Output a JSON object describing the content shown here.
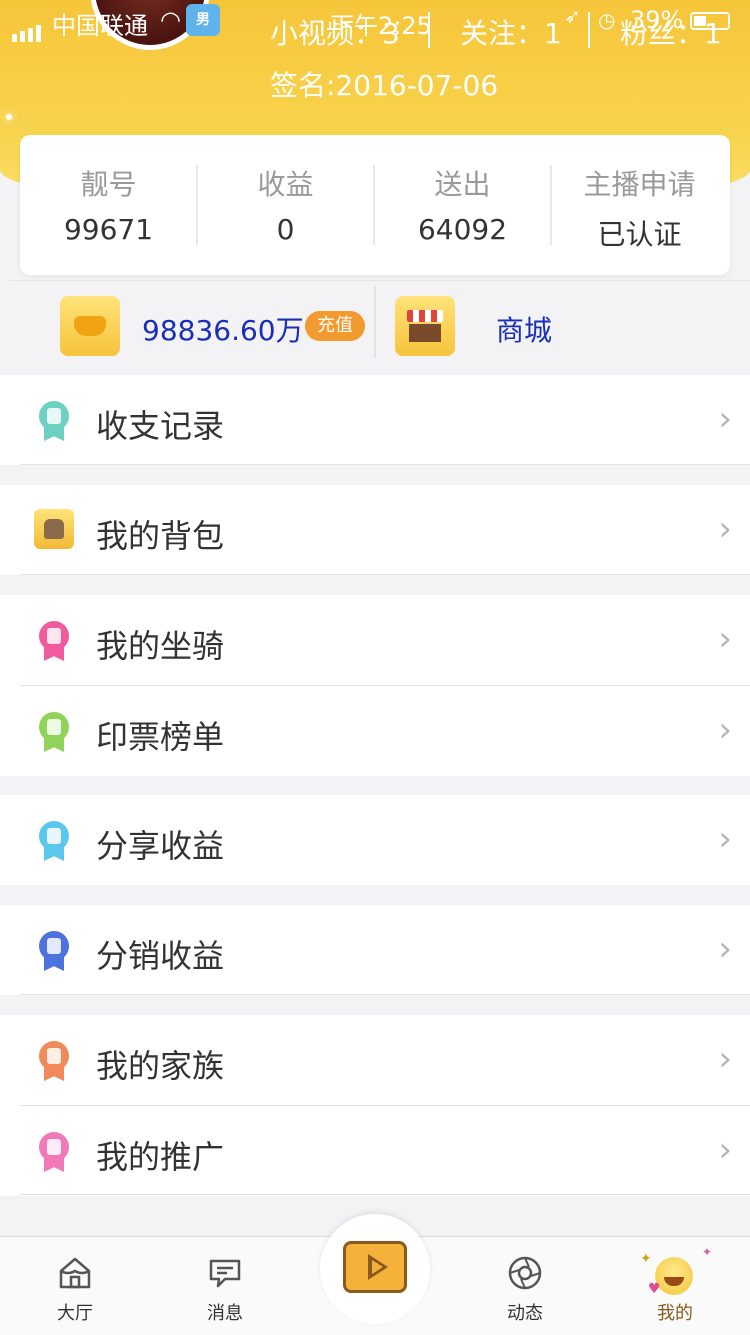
{
  "status_bar": {
    "carrier": "中国联通",
    "wifi_icon": "wifi-icon",
    "time": "下午2:25",
    "battery_percent": "39%"
  },
  "profile": {
    "gender_badge": "男",
    "stats": [
      {
        "label": "小视频：3"
      },
      {
        "label": "关注：1"
      },
      {
        "label": "粉丝：1"
      }
    ],
    "signature": "签名:2016-07-06"
  },
  "info_card": [
    {
      "label": "靓号",
      "value": "99671"
    },
    {
      "label": "收益",
      "value": "0"
    },
    {
      "label": "送出",
      "value": "64092"
    },
    {
      "label": "主播申请",
      "value": "已认证"
    }
  ],
  "wallet": {
    "coins": "98836.60万",
    "recharge_label": "充值",
    "shop_label": "商城"
  },
  "menu_groups": [
    [
      {
        "label": "收支记录",
        "icon": "ribbon-record-icon",
        "color": "#6cd0c2"
      }
    ],
    [
      {
        "label": "我的背包",
        "icon": "backpack-icon",
        "color": "#f4c34a"
      }
    ],
    [
      {
        "label": "我的坐骑",
        "icon": "ribbon-car-icon",
        "color": "#ef5b9c"
      },
      {
        "label": "印票榜单",
        "icon": "ribbon-ticket-icon",
        "color": "#8fd35a"
      }
    ],
    [
      {
        "label": "分享收益",
        "icon": "ribbon-share-icon",
        "color": "#5cc6ec"
      }
    ],
    [
      {
        "label": "分销收益",
        "icon": "ribbon-distribution-icon",
        "color": "#4d72de"
      }
    ],
    [
      {
        "label": "我的家族",
        "icon": "ribbon-family-icon",
        "color": "#f08a5b"
      },
      {
        "label": "我的推广",
        "icon": "ribbon-promotion-icon",
        "color": "#f07ab8"
      }
    ]
  ],
  "tabbar": {
    "tabs": [
      {
        "label": "大厅",
        "icon": "hall-icon"
      },
      {
        "label": "消息",
        "icon": "message-icon"
      },
      {
        "label": "动态",
        "icon": "aperture-icon"
      },
      {
        "label": "我的",
        "icon": "me-emoji-icon"
      }
    ],
    "center_icon": "play-video-icon",
    "active_color": "#8a5a1d"
  },
  "colors": {
    "header": "#f7cc44",
    "link_blue": "#1a2eb8",
    "recharge_orange": "#f29a2e"
  }
}
